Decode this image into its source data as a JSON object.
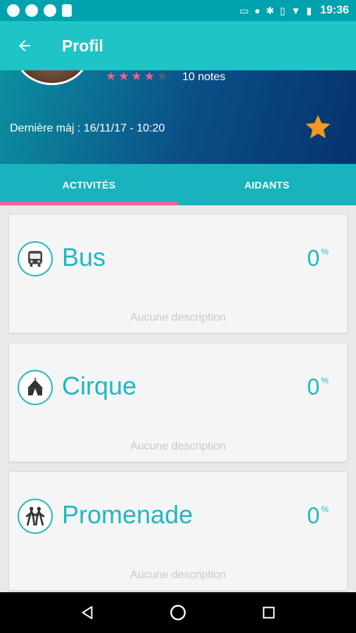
{
  "status_bar": {
    "time": "19:36",
    "left_icons": [
      "app-m-icon",
      "app-m-icon",
      "circle-app-icon",
      "sim-card-icon"
    ],
    "right_icons": [
      "cast-icon",
      "location-icon",
      "bluetooth-icon",
      "vibrate-icon",
      "wifi-icon",
      "battery-icon"
    ]
  },
  "app_bar": {
    "title": "Profil",
    "back_icon": "arrow-left-icon"
  },
  "profile": {
    "rating": {
      "filled": 4,
      "total": 5,
      "count_label": "10 notes"
    },
    "last_update": "Dernière màj : 16/11/17 - 10:20",
    "favorite_icon": "star-icon"
  },
  "tabs": [
    {
      "label": "ACTIVITÉS",
      "active": true
    },
    {
      "label": "AIDANTS",
      "active": false
    }
  ],
  "activities": [
    {
      "title": "Bus",
      "percent": "0",
      "unit": "%",
      "description": "Aucune description",
      "icon": "bus-icon"
    },
    {
      "title": "Cirque",
      "percent": "0",
      "unit": "%",
      "description": "Aucune description",
      "icon": "circus-tent-icon"
    },
    {
      "title": "Promenade",
      "percent": "0",
      "unit": "%",
      "description": "Aucune description",
      "icon": "hikers-icon"
    }
  ],
  "colors": {
    "primary": "#1fc4c7",
    "status_bar": "#00a3ad",
    "tab_bar": "#18b3bc",
    "accent_pink": "#f06292",
    "favorite_star": "#f29a1e"
  }
}
